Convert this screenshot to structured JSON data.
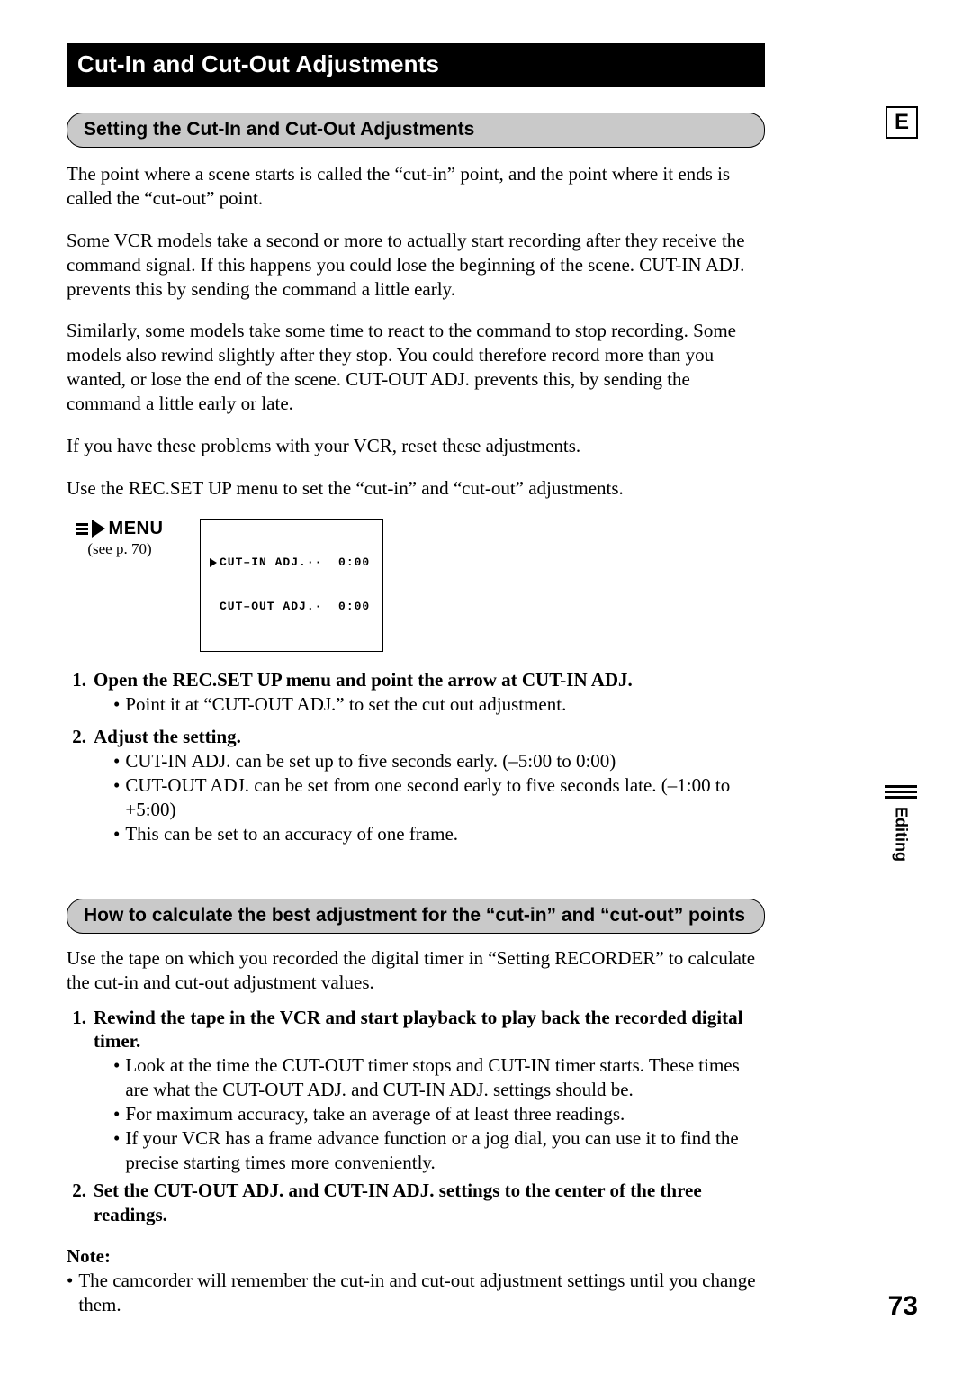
{
  "title": "Cut-In and Cut-Out Adjustments",
  "section1": {
    "heading": "Setting the Cut-In and Cut-Out Adjustments",
    "p1": "The point where a scene starts is called the “cut-in” point, and the point where it ends is called the “cut-out” point.",
    "p2": "Some VCR models take a second or more to actually start recording after they receive the command signal. If this happens you could lose the beginning of the scene. CUT-IN ADJ. prevents this by sending the command a little early.",
    "p3": "Similarly, some models take some time to react to the command to stop recording. Some models also rewind slightly after they stop. You could therefore record more than you wanted, or lose the end of the scene. CUT-OUT ADJ. prevents this, by sending the command a little early or late.",
    "p4": "If you have these problems with your VCR, reset these adjustments.",
    "p5": "Use the REC.SET UP menu to set the “cut-in” and “cut-out” adjustments."
  },
  "menu": {
    "word": "MENU",
    "see": "(see p. 70)",
    "line1": "CUT–IN ADJ.··  0:00",
    "line2": "CUT–OUT ADJ.·  0:00"
  },
  "steps1": {
    "s1_num": "1.",
    "s1_head": "Open the REC.SET UP menu and point the arrow at CUT-IN ADJ.",
    "s1_b1": "Point it at “CUT-OUT ADJ.” to set the cut out adjustment.",
    "s2_num": "2.",
    "s2_head": "Adjust the setting.",
    "s2_b1": "CUT-IN ADJ. can be set up to five seconds early. (–5:00 to 0:00)",
    "s2_b2": "CUT-OUT ADJ. can be set from one second early to five seconds late. (–1:00 to +5:00)",
    "s2_b3": "This can be set to an accuracy of one frame."
  },
  "section2": {
    "heading": "How to calculate the best adjustment for the “cut-in” and “cut-out” points",
    "p1": "Use the tape on which you recorded the digital timer in “Setting RECORDER” to calculate the cut-in and cut-out adjustment values."
  },
  "steps2": {
    "s1_num": "1.",
    "s1_head": "Rewind the tape in the VCR and start playback to play back the recorded digital timer.",
    "s1_b1": "Look at the time the CUT-OUT timer stops and CUT-IN timer starts. These times are what the CUT-OUT ADJ. and CUT-IN ADJ. settings should be.",
    "s1_b2": "For maximum accuracy, take an average of at least three readings.",
    "s1_b3": "If your VCR has a frame advance function or a jog dial, you can use it to find the precise starting times more conveniently.",
    "s2_num": "2.",
    "s2_head": "Set the CUT-OUT ADJ. and CUT-IN ADJ. settings to the center of the three readings."
  },
  "note": {
    "head": "Note:",
    "b1": "The camcorder will remember the cut-in and cut-out adjustment settings until you change them."
  },
  "side": {
    "e": "E",
    "editing": "Editing"
  },
  "page_number": "73"
}
